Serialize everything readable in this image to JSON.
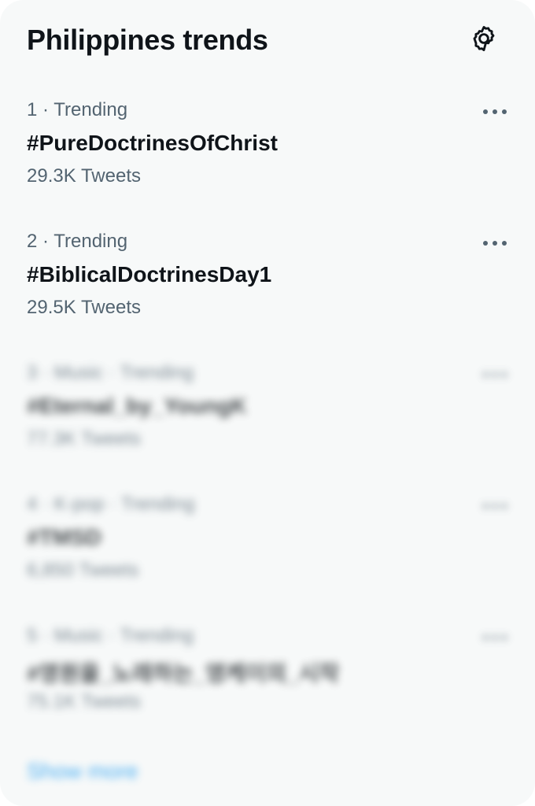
{
  "header": {
    "title": "Philippines trends",
    "settings_icon": "gear-icon"
  },
  "trends": [
    {
      "meta": "1 · Trending",
      "name": "#PureDoctrinesOfChrist",
      "count": "29.3K Tweets"
    },
    {
      "meta": "2 · Trending",
      "name": "#BiblicalDoctrinesDay1",
      "count": "29.5K Tweets"
    },
    {
      "meta": "3 · Music · Trending",
      "name": "#Eternal_by_YoungK",
      "count": "77.3K Tweets"
    },
    {
      "meta": "4 · K-pop · Trending",
      "name": "#TMSD",
      "count": "6,850 Tweets"
    },
    {
      "meta": "5 · Music · Trending",
      "name": "#영원을_노래하는_영케이의_시작",
      "count": "75.1K Tweets"
    }
  ],
  "footer": {
    "show_more": "Show more"
  },
  "colors": {
    "background": "#f7f9f9",
    "text_primary": "#0f1419",
    "text_secondary": "#536471",
    "accent": "#1d9bf0"
  }
}
